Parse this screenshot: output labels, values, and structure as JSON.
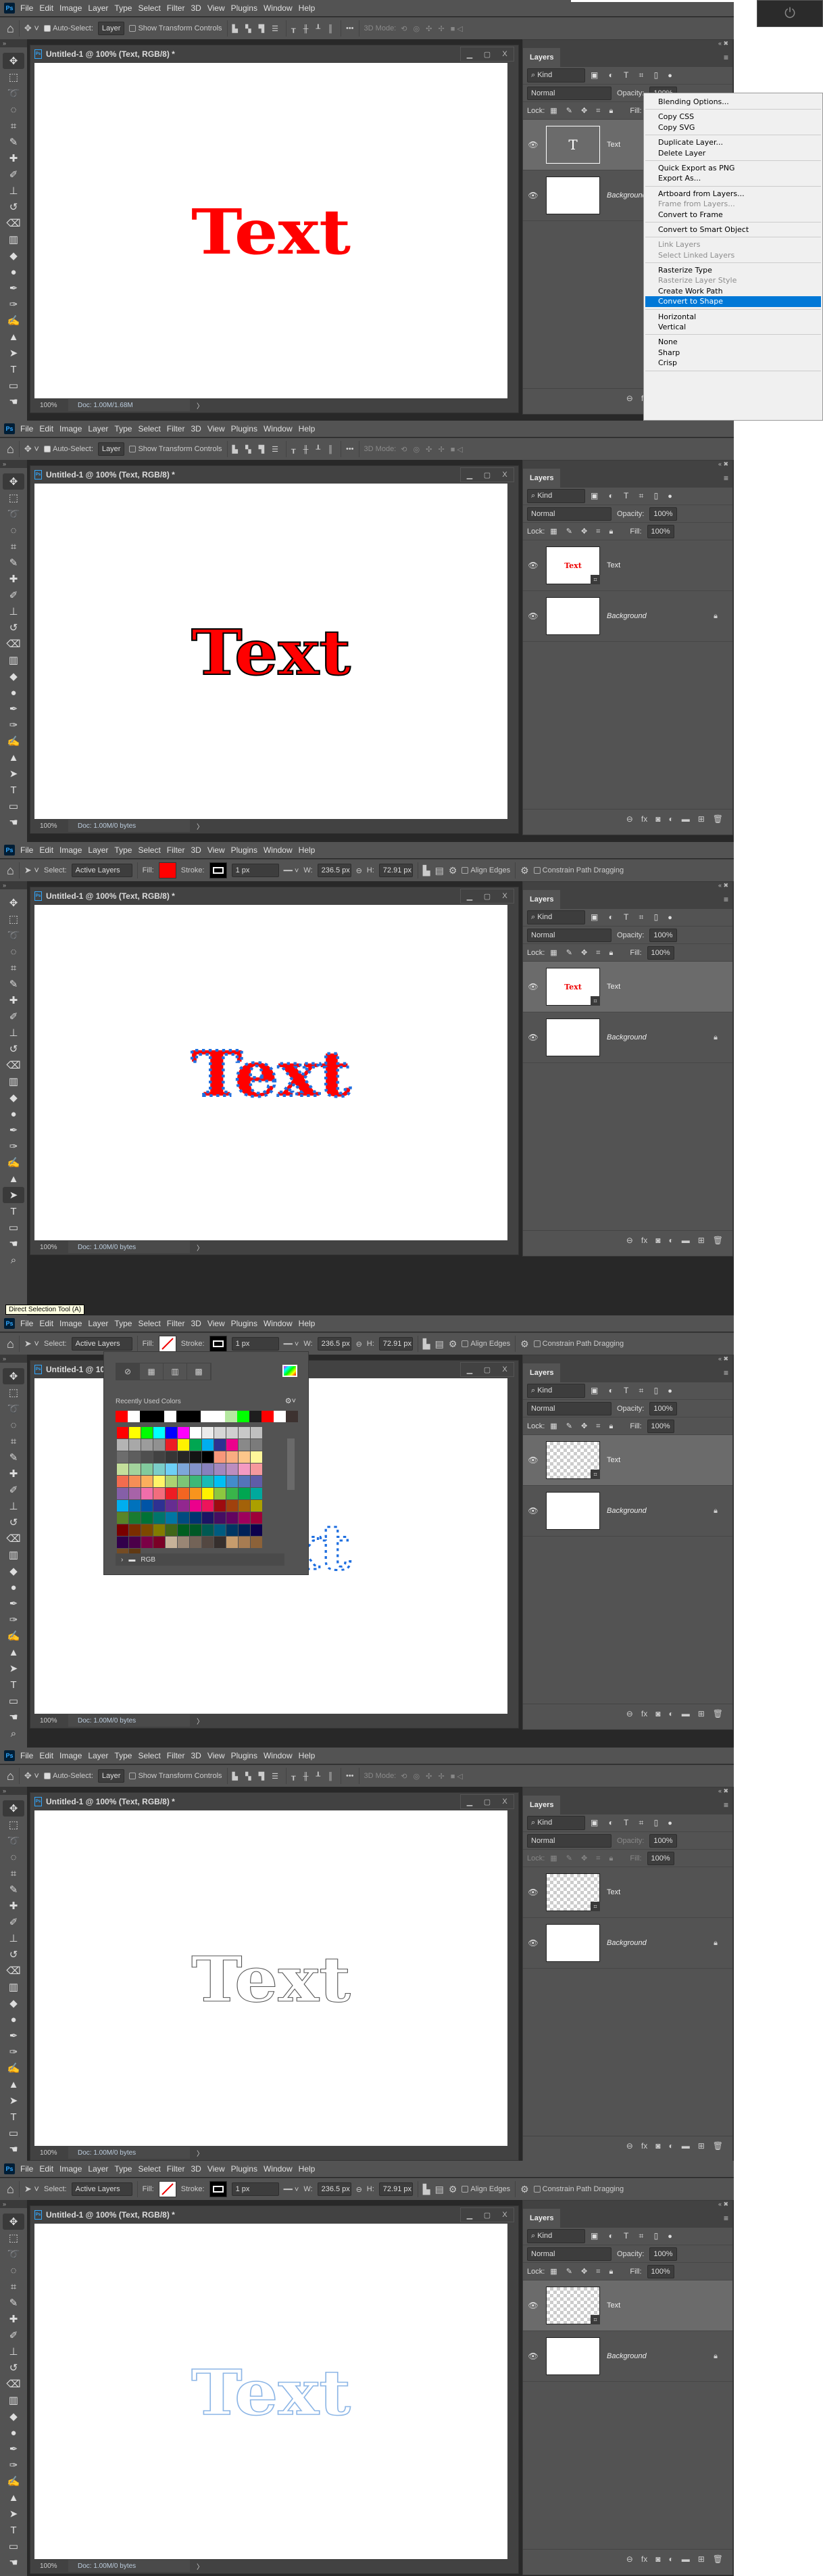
{
  "app": {
    "logo": "Ps",
    "menu": [
      "File",
      "Edit",
      "Image",
      "Layer",
      "Type",
      "Select",
      "Filter",
      "3D",
      "View",
      "Plugins",
      "Window",
      "Help"
    ],
    "doc_title": "Untitled-1 @ 100% (Text, RGB/8) *",
    "zoom": "100%"
  },
  "options_move": {
    "auto_select": "Auto-Select:",
    "layer": "Layer",
    "show_transform": "Show Transform Controls",
    "more": "•••",
    "mode3d": "3D Mode:"
  },
  "options_path": {
    "select_label": "Select:",
    "select_value": "Active Layers",
    "fill_label": "Fill:",
    "stroke_label": "Stroke:",
    "stroke_width": "1 px",
    "w_label": "W:",
    "w": "236.5 px",
    "h_label": "H:",
    "h": "72.91 px",
    "align_edges": "Align Edges",
    "constrain": "Constrain Path Dragging"
  },
  "layers": {
    "tab": "Layers",
    "kind": "Kind",
    "blend": "Normal",
    "opacity_label": "Opacity:",
    "opacity": "100%",
    "lock_label": "Lock:",
    "fill_label": "Fill:",
    "fill": "100%",
    "text_layer": "Text",
    "background_layer": "Background",
    "type_thumb": "T",
    "mini_text": "Text"
  },
  "canvas_text": "Text",
  "colors": {
    "red": "#ff0000",
    "anchor_blue": "#1f6fe0",
    "outline_gray": "#555555",
    "outline_blue": "#8db6e6",
    "menu_highlight": "#0078d7"
  },
  "panels": [
    {
      "status": "Doc: 1.00M/1.68M",
      "options": "move",
      "text_style": "red",
      "thumb": "type",
      "selected": true,
      "fill_color": ""
    },
    {
      "status": "Doc: 1.00M/0 bytes",
      "options": "move",
      "text_style": "red-stroke",
      "thumb": "mini",
      "selected": false,
      "fill_color": ""
    },
    {
      "status": "Doc: 1.00M/0 bytes",
      "options": "path",
      "text_style": "red-anchors",
      "thumb": "mini",
      "selected": true,
      "fill_color": "#ff0000"
    },
    {
      "status": "Doc: 1.00M/0 bytes",
      "options": "path",
      "text_style": "blue-anchors",
      "thumb": "checker",
      "selected": true,
      "fill_color": "none"
    },
    {
      "status": "Doc: 1.00M/0 bytes",
      "options": "move",
      "text_style": "outline-gray",
      "thumb": "checker",
      "selected": false,
      "fill_color": "",
      "layers_disabled": true
    },
    {
      "status": "Doc: 1.00M/0 bytes",
      "options": "path",
      "text_style": "outline-blue",
      "thumb": "checker",
      "selected": true,
      "fill_color": "none"
    }
  ],
  "context_menu": [
    [
      {
        "label": "Blending Options..."
      }
    ],
    [
      {
        "label": "Copy CSS"
      },
      {
        "label": "Copy SVG"
      }
    ],
    [
      {
        "label": "Duplicate Layer..."
      },
      {
        "label": "Delete Layer"
      }
    ],
    [
      {
        "label": "Quick Export as PNG"
      },
      {
        "label": "Export As..."
      }
    ],
    [
      {
        "label": "Artboard from Layers..."
      },
      {
        "label": "Frame from Layers...",
        "disabled": true
      },
      {
        "label": "Convert to Frame"
      }
    ],
    [
      {
        "label": "Convert to Smart Object"
      }
    ],
    [
      {
        "label": "Link Layers",
        "disabled": true
      },
      {
        "label": "Select Linked Layers",
        "disabled": true
      }
    ],
    [
      {
        "label": "Rasterize Type"
      },
      {
        "label": "Rasterize Layer Style",
        "disabled": true
      },
      {
        "label": "Create Work Path"
      },
      {
        "label": "Convert to Shape",
        "highlighted": true
      }
    ],
    [
      {
        "label": "Horizontal"
      },
      {
        "label": "Vertical"
      }
    ],
    [
      {
        "label": "None"
      },
      {
        "label": "Sharp"
      },
      {
        "label": "Crisp"
      }
    ]
  ],
  "tooltip": "Direct Selection Tool (A)",
  "swatches": {
    "recent_label": "Recently Used Colors",
    "folder": "RGB",
    "recent": [
      "#ff0000",
      "#ffffff",
      "#000000",
      "#000000",
      "#ffffff",
      "#000000",
      "#000000",
      "#ffffff",
      "#ffffff",
      "#b5e8a0",
      "#00ff00",
      "#1e1e1e",
      "#ff0000",
      "#ffffff",
      "#3d3230"
    ],
    "grid": [
      "#ff0000",
      "#ffff00",
      "#00ff00",
      "#00ffff",
      "#0000ff",
      "#ff00ff",
      "#ffffff",
      "#ebebeb",
      "#d6d6d6",
      "#d0d0d0",
      "#c8c8c8",
      "#bfbfbf",
      "#b4b4b4",
      "#a8a8a8",
      "#9c9c9c",
      "#919191",
      "#ed1c24",
      "#fff200",
      "#00a651",
      "#00aeef",
      "#2e3192",
      "#ec008c",
      "#898989",
      "#7b7b7b",
      "#6d6d6d",
      "#5e5e5e",
      "#4f4f4f",
      "#424242",
      "#363636",
      "#262626",
      "#141414",
      "#000000",
      "#f7977a",
      "#f9ad81",
      "#fdc68a",
      "#fff79a",
      "#c4df9b",
      "#a3d39c",
      "#82ca9d",
      "#7bcdc8",
      "#6dcff6",
      "#7da7d9",
      "#8393ca",
      "#8781bd",
      "#a187be",
      "#bc8dbf",
      "#f49ac2",
      "#f6989d",
      "#f26c4f",
      "#f68e56",
      "#fbaf5d",
      "#fff568",
      "#acd372",
      "#7cc576",
      "#3bb878",
      "#1abbb4",
      "#00bff3",
      "#438ccb",
      "#5574b9",
      "#605ca8",
      "#855fa8",
      "#a763a8",
      "#f06eaa",
      "#f26d7d",
      "#ed1c24",
      "#f26522",
      "#f7941d",
      "#fff200",
      "#8dc73f",
      "#39b54a",
      "#00a651",
      "#00a99d",
      "#00aeef",
      "#0072bc",
      "#0054a6",
      "#2e3192",
      "#662d91",
      "#92278f",
      "#ec008c",
      "#ed145b",
      "#9e0b0f",
      "#a0410d",
      "#a36209",
      "#aba000",
      "#598527",
      "#197b30",
      "#007236",
      "#00746b",
      "#0076a3",
      "#004b80",
      "#003471",
      "#1b1464",
      "#440e62",
      "#630460",
      "#9e005d",
      "#9e0039",
      "#790000",
      "#7b2e00",
      "#7d4900",
      "#827b00",
      "#406618",
      "#005e20",
      "#005826",
      "#005952",
      "#005b7f",
      "#003663",
      "#002157",
      "#0d004c",
      "#32004b",
      "#4b0049",
      "#7b0046",
      "#7a0026",
      "#c7b299",
      "#998675",
      "#736357",
      "#534741",
      "#362f2d",
      "#c69c6d",
      "#a67c52",
      "#8c6239",
      "#754c24",
      "#603913"
    ]
  }
}
